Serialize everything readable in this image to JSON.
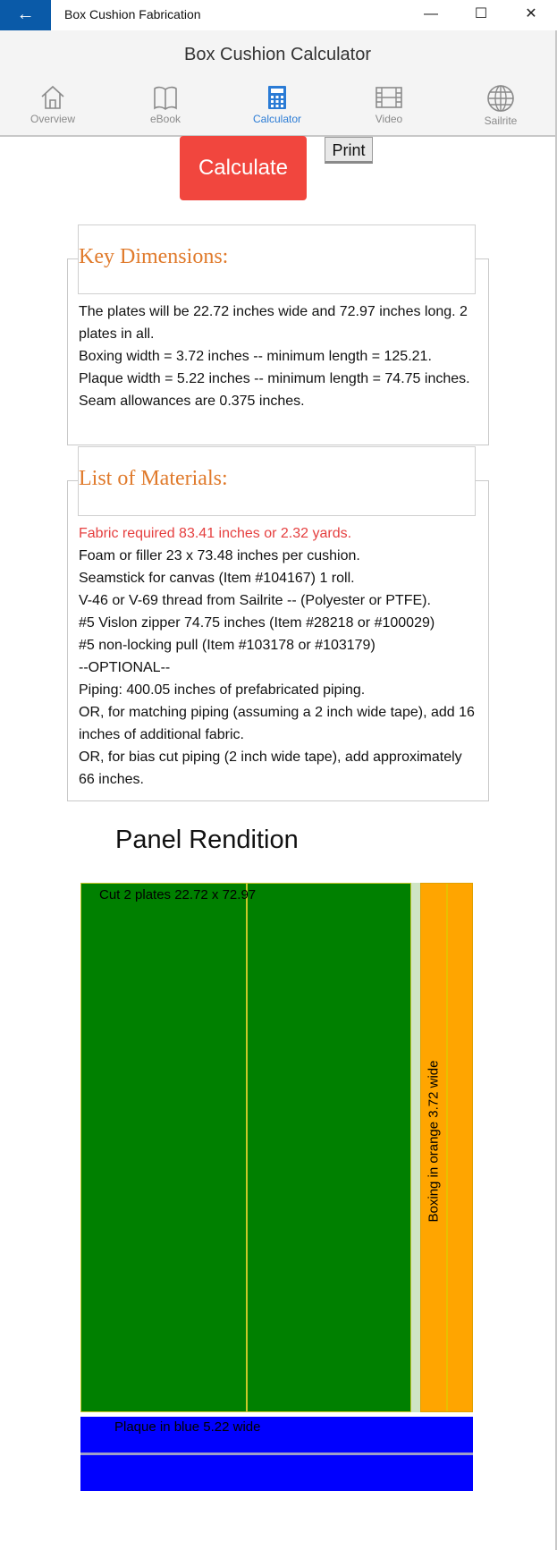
{
  "window": {
    "back_glyph": "←",
    "title": "Box Cushion Fabrication",
    "minimize_glyph": "—",
    "maximize_glyph": "☐",
    "close_glyph": "✕"
  },
  "header": {
    "app_title": "Box Cushion Calculator",
    "tabs": [
      {
        "label": "Overview",
        "icon": "home-icon",
        "active": false
      },
      {
        "label": "eBook",
        "icon": "book-icon",
        "active": false
      },
      {
        "label": "Calculator",
        "icon": "calculator-icon",
        "active": true
      },
      {
        "label": "Video",
        "icon": "film-icon",
        "active": false
      },
      {
        "label": "Sailrite",
        "icon": "globe-icon",
        "active": false
      }
    ]
  },
  "actions": {
    "calculate_label": "Calculate",
    "print_label": "Print"
  },
  "key_dimensions": {
    "legend": "Key Dimensions:",
    "lines": [
      "The plates will be 22.72 inches wide and 72.97 inches long. 2 plates in all.",
      "Boxing width = 3.72 inches -- minimum length = 125.21.",
      "Plaque width = 5.22 inches -- minimum length = 74.75 inches.",
      "Seam allowances are 0.375 inches."
    ]
  },
  "materials": {
    "legend": "List of Materials:",
    "fabric_required": "Fabric required 83.41 inches or 2.32 yards.",
    "lines": [
      "Foam or filler 23 x 73.48 inches per cushion.",
      "Seamstick for canvas (Item #104167) 1 roll.",
      "V-46 or V-69 thread from Sailrite -- (Polyester or PTFE).",
      "#5 Vislon zipper 74.75 inches (Item #28218 or #100029)",
      "#5 non-locking pull (Item #103178 or #103179)",
      "--OPTIONAL--",
      "Piping: 400.05 inches of prefabricated piping.",
      "OR, for matching piping (assuming a 2 inch wide tape), add 16 inches of additional fabric.",
      "OR, for bias cut piping (2 inch wide tape), add approximately 66 inches."
    ]
  },
  "panel": {
    "title": "Panel Rendition",
    "plates_label": "Cut 2 plates 22.72 x 72.97",
    "boxing_label": "Boxing in orange 3.72 wide",
    "plaque_label": "Plaque in blue 5.22 wide",
    "colors": {
      "plates": "#008000",
      "boxing": "#ffa500",
      "plaque": "#0000ff",
      "accent": "#e07a2b",
      "button": "#f1463e"
    }
  }
}
